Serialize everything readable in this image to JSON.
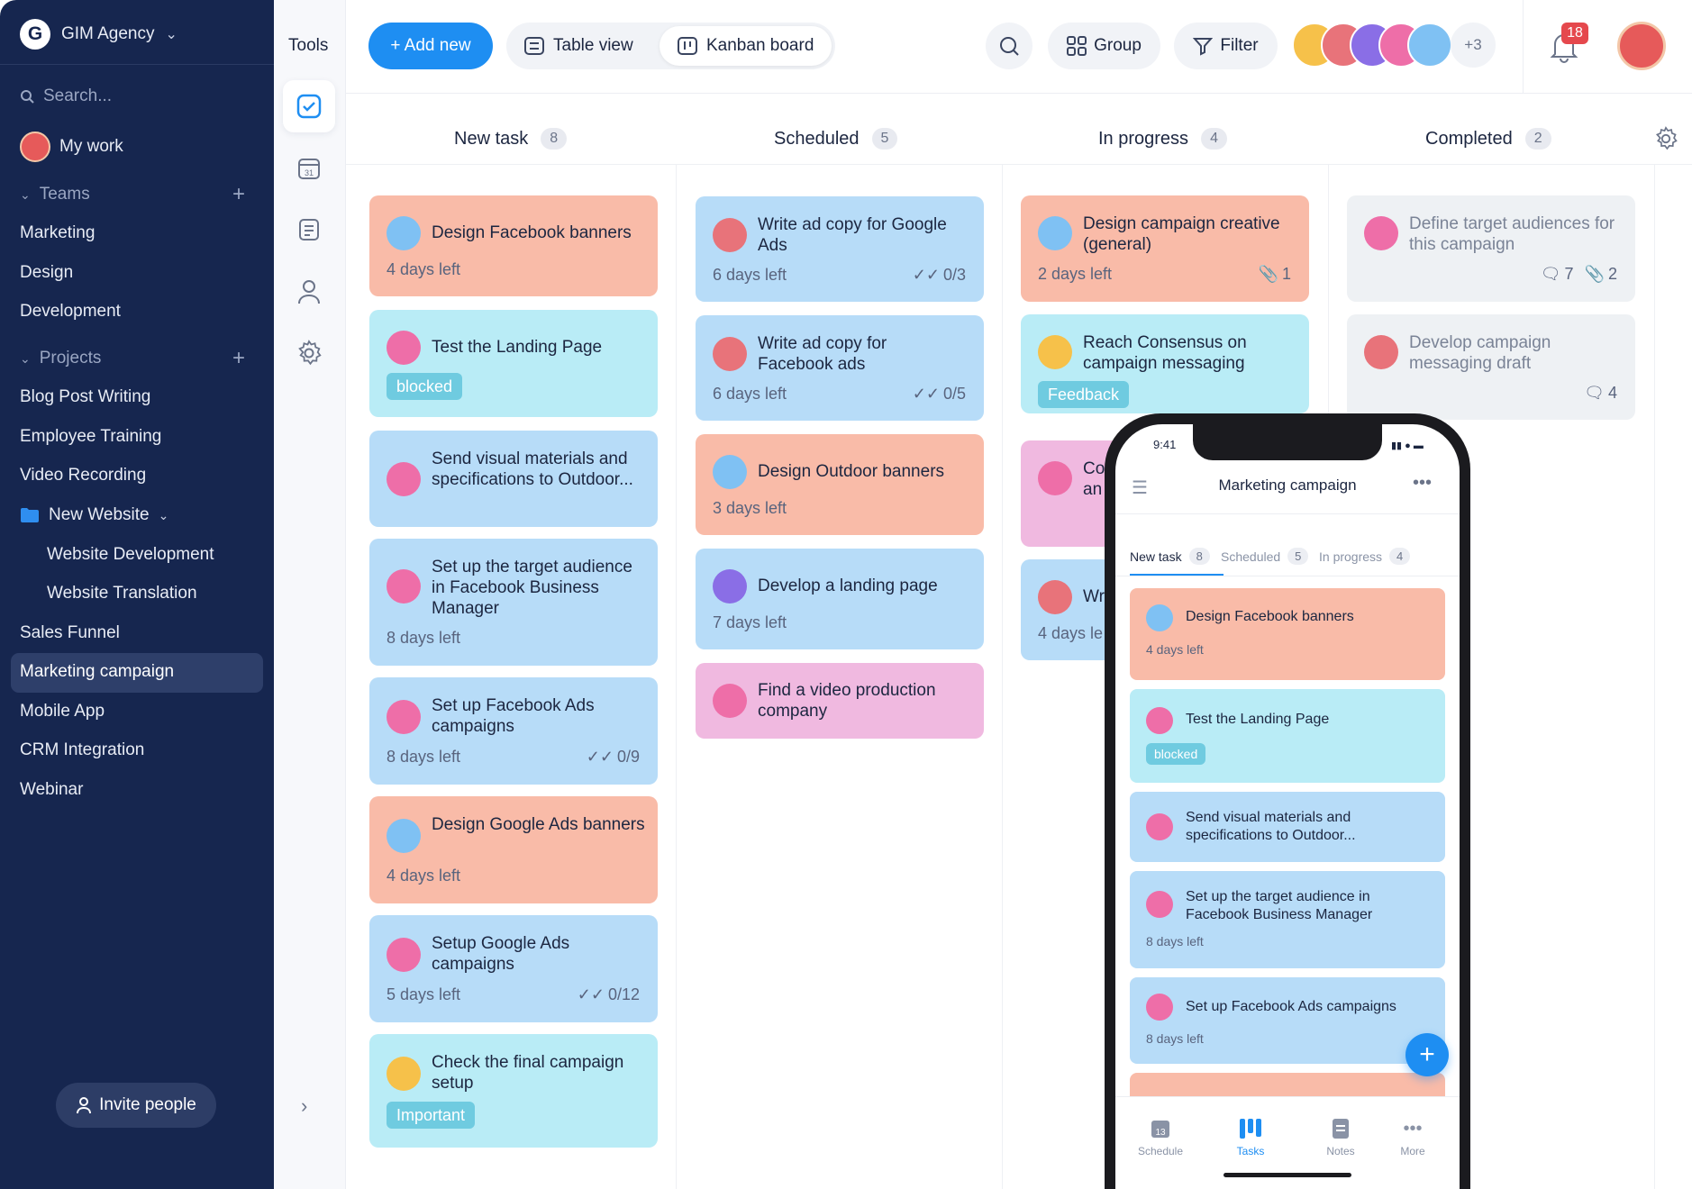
{
  "sidebar": {
    "workspace": "GIM Agency",
    "search_placeholder": "Search...",
    "my_work": "My work",
    "teams_label": "Teams",
    "teams": [
      "Marketing",
      "Design",
      "Development"
    ],
    "projects_label": "Projects",
    "projects": [
      "Blog Post Writing",
      "Employee Training",
      "Video Recording"
    ],
    "folder": "New Website",
    "folder_items": [
      "Website Development",
      "Website Translation"
    ],
    "projects_more": [
      "Sales Funnel",
      "Marketing campaign",
      "Mobile App",
      "CRM Integration",
      "Webinar"
    ],
    "active_project": "Marketing campaign",
    "invite": "Invite people"
  },
  "tools": {
    "title": "Tools"
  },
  "toolbar": {
    "add_new": "+ Add new",
    "table_view": "Table view",
    "kanban_board": "Kanban board",
    "group": "Group",
    "filter": "Filter",
    "more_members": "+3",
    "notifications": "18"
  },
  "columns": [
    {
      "title": "New task",
      "count": "8"
    },
    {
      "title": "Scheduled",
      "count": "5"
    },
    {
      "title": "In progress",
      "count": "4"
    },
    {
      "title": "Completed",
      "count": "2"
    }
  ],
  "cards": {
    "new_task": [
      {
        "title": "Design Facebook banners",
        "due": "4 days left"
      },
      {
        "title": "Test the Landing Page",
        "tag": "blocked"
      },
      {
        "title": "Send visual materials and specifications to Outdoor..."
      },
      {
        "title": "Set up the target audience in Facebook Business Manager",
        "due": "8 days left"
      },
      {
        "title": "Set up Facebook Ads campaigns",
        "due": "8 days left",
        "checklist": "0/9"
      },
      {
        "title": "Design Google Ads banners",
        "due": "4 days left"
      },
      {
        "title": "Setup Google Ads campaigns",
        "due": "5 days left",
        "checklist": "0/12"
      },
      {
        "title": "Check the final campaign setup",
        "tag": "Important"
      }
    ],
    "scheduled": [
      {
        "title": "Write ad copy for Google Ads",
        "due": "6 days left",
        "checklist": "0/3"
      },
      {
        "title": "Write ad copy for Facebook ads",
        "due": "6 days left",
        "checklist": "0/5"
      },
      {
        "title": "Design Outdoor banners",
        "due": "3 days left"
      },
      {
        "title": "Develop a landing page",
        "due": "7 days left"
      },
      {
        "title": "Find a video production company"
      }
    ],
    "in_progress": [
      {
        "title": "Design campaign creative (general)",
        "due": "2 days left",
        "attachments": "1"
      },
      {
        "title": "Reach Consensus on campaign messaging",
        "tag": "Feedback"
      },
      {
        "title": "Co an",
        "partial": true
      },
      {
        "title": "Wr",
        "due": "4 days le"
      }
    ],
    "completed": [
      {
        "title": "Define target audiences for this campaign",
        "comments": "7",
        "attachments": "2"
      },
      {
        "title": "Develop campaign messaging draft",
        "comments": "4"
      }
    ]
  },
  "phone": {
    "time": "9:41",
    "title": "Marketing campaign",
    "tabs": [
      {
        "label": "New task",
        "count": "8"
      },
      {
        "label": "Scheduled",
        "count": "5"
      },
      {
        "label": "In progress",
        "count": "4"
      }
    ],
    "cards": [
      {
        "title": "Design Facebook banners",
        "due": "4 days left"
      },
      {
        "title": "Test the Landing Page",
        "tag": "blocked"
      },
      {
        "title": "Send visual materials and specifications to Outdoor..."
      },
      {
        "title": "Set up the target audience in Facebook Business Manager",
        "due": "8 days left"
      },
      {
        "title": "Set up Facebook Ads campaigns",
        "due": "8 days left"
      }
    ],
    "nav": [
      "Schedule",
      "Tasks",
      "Notes",
      "More"
    ],
    "calendar_day": "13"
  },
  "colors": {
    "sidebar_bg": "#16264f",
    "accent_blue": "#1e8ef2",
    "card_salmon": "#f9bba8",
    "card_blue": "#b7dcf8",
    "card_cyan": "#b9ecf6",
    "card_pink": "#f0b9e0",
    "tag_blocked": "#6fcbe0",
    "tag_important": "#6fcbe0",
    "badge_red": "#e5484d"
  }
}
